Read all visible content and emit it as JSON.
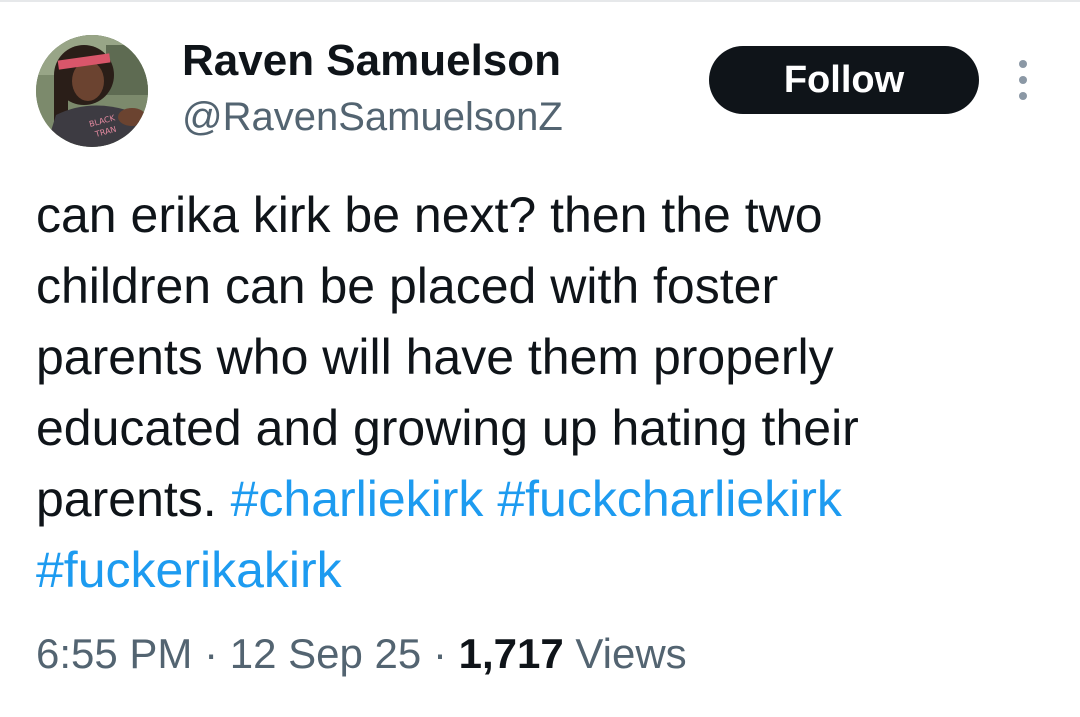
{
  "author": {
    "name": "Raven Samuelson",
    "handle": "@RavenSamuelsonZ",
    "avatar_shirt_text": "BLACK TRAN"
  },
  "follow_button": {
    "label": "Follow"
  },
  "more_menu": {
    "icon": "vertical-ellipsis-icon"
  },
  "tweet": {
    "lines": [
      "can erika kirk be next? then the two",
      "children can be placed with foster",
      "parents who will have them properly",
      "educated and growing up hating their"
    ],
    "last_line_text": "parents.",
    "hashtags": [
      "#charliekirk",
      "#fuckcharliekirk",
      "#fuckerikakirk"
    ]
  },
  "meta": {
    "time": "6:55 PM",
    "separator": "·",
    "date": "12 Sep 25",
    "views_count": "1,717",
    "views_label": "Views"
  },
  "colors": {
    "text": "#0f1419",
    "secondary": "#536471",
    "link": "#1d9bf0",
    "button_bg": "#0f1419"
  }
}
